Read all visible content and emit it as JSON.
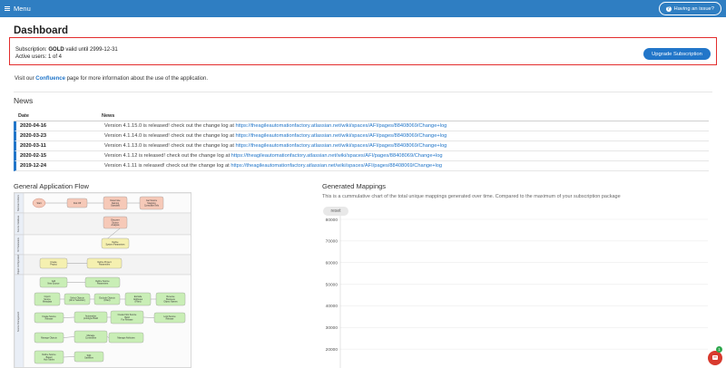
{
  "topbar": {
    "menu_label": "Menu",
    "issue_label": "Having an issue?"
  },
  "page": {
    "title": "Dashboard"
  },
  "subscription": {
    "label": "Subscription:",
    "plan": "GOLD",
    "valid_text": "valid until 2999-12-31",
    "users_text": "Active users: 1 of 4",
    "upgrade_label": "Upgrade Subscription"
  },
  "visit": {
    "prefix": "Visit our",
    "link": "Confluence",
    "suffix": "page for more information about the use of the application."
  },
  "news": {
    "title": "News",
    "headers": {
      "date": "Date",
      "news": "News"
    },
    "url": "https://theagileautomationfactory.atlassian.net/wiki/spaces/AFI/pages/88408069/Change+log",
    "rows": [
      {
        "date": "2020-04-16",
        "text": "Version 4.1.15.0 is released! check out the change log at"
      },
      {
        "date": "2020-03-23",
        "text": "Version 4.1.14.0 is released! check out the change log at"
      },
      {
        "date": "2020-03-11",
        "text": "Version 4.1.13.0 is released! check out the change log at"
      },
      {
        "date": "2020-02-15",
        "text": "Version 4.1.12 is released! check out the change log at"
      },
      {
        "date": "2019-12-24",
        "text": "Version 4.1.11 is released! check out the change log at"
      }
    ]
  },
  "flow": {
    "title": "General Application Flow",
    "lanes": [
      "Standard Actions",
      "Source Database",
      "MI Parameters",
      "Project Configuration",
      "Source Management"
    ],
    "nodes": [
      {
        "text": [
          "Start"
        ],
        "color": "#f6c9b8"
      },
      {
        "text": [
          "Kick Off"
        ],
        "color": "#f6c9b8"
      },
      {
        "text": [
          "Determine",
          "Naming",
          "Standard"
        ],
        "color": "#f6c9b8"
      },
      {
        "text": [
          "Get Source",
          "Mapping",
          "Consultant Info"
        ],
        "color": "#f6c9b8"
      },
      {
        "text": [
          "Discover",
          "Source",
          "Analysis"
        ],
        "color": "#f6c9b8"
      },
      {
        "text": [
          "Define",
          "System Parameters"
        ],
        "color": "#f5f0b0"
      },
      {
        "text": [
          "Create",
          "Project"
        ],
        "color": "#f5f0b0"
      },
      {
        "text": [
          "Define Project",
          "Parameters"
        ],
        "color": "#f5f0b0"
      },
      {
        "text": [
          "Add",
          "New Source"
        ],
        "color": "#c9eeb6"
      },
      {
        "text": [
          "Define Source",
          "Parameters"
        ],
        "color": "#c9eeb6"
      },
      {
        "text": [
          "Import",
          "Source",
          "Metadata"
        ],
        "color": "#c9eeb6"
      },
      {
        "text": [
          "Select Objects",
          "(All or Selection)"
        ],
        "color": "#c9eeb6"
      },
      {
        "text": [
          "Exclude Objects",
          "(Filter)"
        ],
        "color": "#c9eeb6"
      },
      {
        "text": [
          "Exclude",
          "Attributes",
          "(Filter)"
        ],
        "color": "#c9eeb6"
      },
      {
        "text": [
          "Reverse",
          "Business",
          "Object Names"
        ],
        "color": "#c9eeb6"
      },
      {
        "text": [
          "Create Source",
          "Release"
        ],
        "color": "#c9eeb6"
      },
      {
        "text": [
          "Automation",
          "prototype Build"
        ],
        "color": "#c9eeb6"
      },
      {
        "text": [
          "Create First Source",
          "Build",
          "For Release"
        ],
        "color": "#c9eeb6"
      },
      {
        "text": [
          "Lock Source",
          "Release"
        ],
        "color": "#c9eeb6"
      },
      {
        "text": [
          "Manage Objects"
        ],
        "color": "#c9eeb6"
      },
      {
        "text": [
          "Manage",
          "Constraints"
        ],
        "color": "#c9eeb6"
      },
      {
        "text": [
          "Manage Attributes"
        ],
        "color": "#c9eeb6"
      },
      {
        "text": [
          "Define Source",
          "Based",
          "Hub Tables"
        ],
        "color": "#c9eeb6"
      },
      {
        "text": [
          "Split",
          "Satellites"
        ],
        "color": "#c9eeb6"
      }
    ]
  },
  "mappings": {
    "title": "Generated Mappings",
    "description": "This is a cummulative chart of the total unique mappings generated over time. Compared to the maximum of your subscription package",
    "reset_label": "reset"
  },
  "chart_data": {
    "type": "line",
    "title": "",
    "xlabel": "",
    "ylabel": "",
    "y_ticks": [
      80000,
      70000,
      60000,
      50000,
      40000,
      30000,
      20000
    ],
    "ylim": [
      10000,
      80000
    ],
    "grid": true,
    "series": []
  },
  "chat": {
    "badge": "1"
  }
}
